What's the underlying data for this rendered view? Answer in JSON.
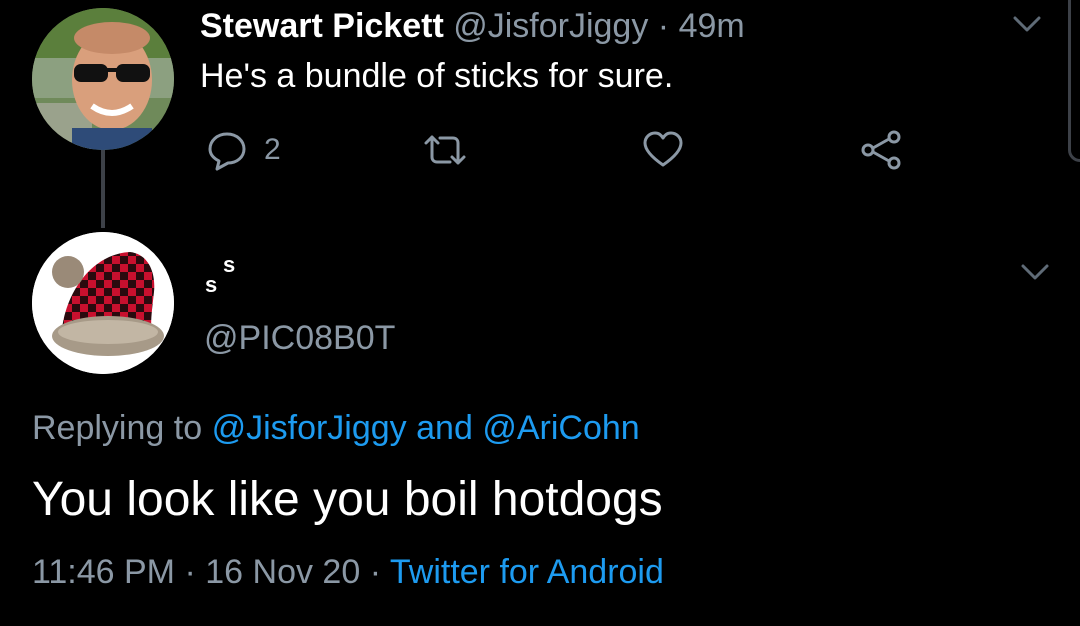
{
  "parent_tweet": {
    "author_name": "Stewart Pickett",
    "author_handle": "@JisforJiggy",
    "separator": "·",
    "time_ago": "49m",
    "text": "He's a bundle of sticks for sure.",
    "reply_count": "2",
    "icons": {
      "reply": "reply-icon",
      "retweet": "retweet-icon",
      "like": "heart-icon",
      "share": "share-icon",
      "menu": "chevron-down-icon"
    }
  },
  "reply_tweet": {
    "display_name_part1": "s",
    "display_name_part2": "s",
    "handle": "@PIC08B0T",
    "replying_prefix": "Replying to",
    "replying_mention1": "@JisforJiggy",
    "replying_and": "and",
    "replying_mention2": "@AriCohn",
    "text": "You look like you boil hotdogs",
    "time": "11:46 PM",
    "separator": "·",
    "date": "16 Nov 20",
    "source": "Twitter for Android",
    "icons": {
      "menu": "chevron-down-icon"
    }
  },
  "colors": {
    "background": "#000000",
    "primary_text": "#ffffff",
    "secondary_text": "#8b98a5",
    "link": "#1d9bf0",
    "thread_line": "#3d4148"
  }
}
